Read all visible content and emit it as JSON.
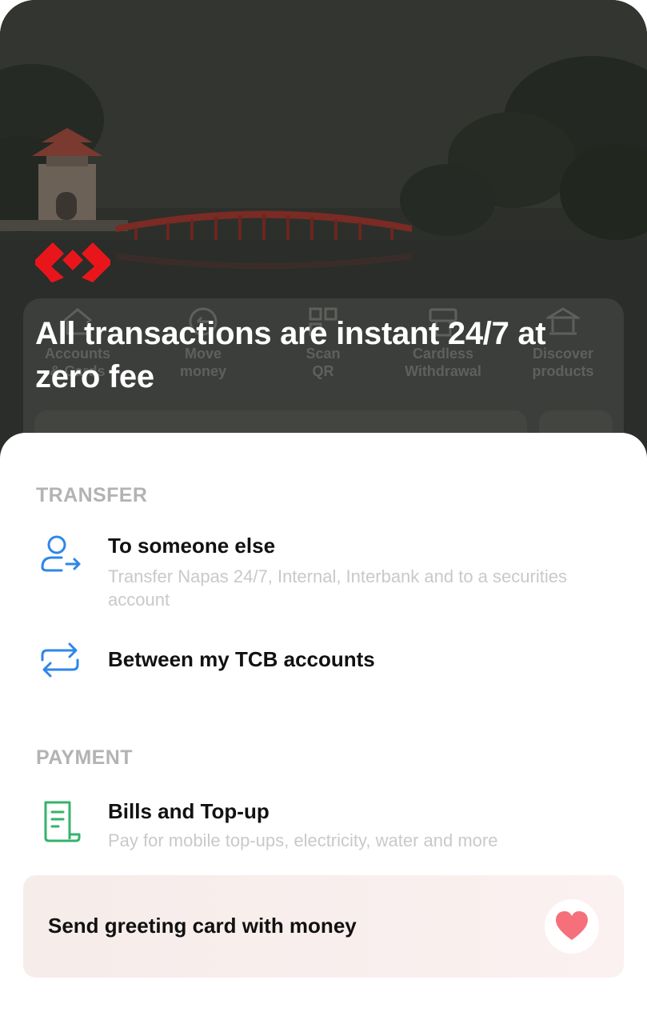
{
  "hero": {
    "headline": "All transactions are instant 24/7 at zero fee",
    "brand_color": "#e8161b"
  },
  "quick_actions": [
    {
      "icon": "accounts-cards-icon",
      "label": "Accounts\n& Cards"
    },
    {
      "icon": "move-money-icon",
      "label": "Move\nmoney"
    },
    {
      "icon": "scan-qr-icon",
      "label": "Scan\nQR"
    },
    {
      "icon": "cardless-withdrawal-icon",
      "label": "Cardless\nWithdrawal"
    },
    {
      "icon": "discover-products-icon",
      "label": "Discover\nproducts"
    }
  ],
  "sheet": {
    "transfer": {
      "title": "TRANSFER",
      "items": [
        {
          "icon": "user-transfer-icon",
          "title": "To someone else",
          "subtitle": "Transfer Napas 24/7, Internal, Interbank and to a securities account"
        },
        {
          "icon": "swap-arrows-icon",
          "title": "Between my TCB accounts"
        }
      ]
    },
    "payment": {
      "title": "PAYMENT",
      "items": [
        {
          "icon": "bill-receipt-icon",
          "title": "Bills and Top-up",
          "subtitle": "Pay for mobile top-ups, electricity, water and more"
        }
      ]
    },
    "greeting": {
      "label": "Send greeting card with money",
      "icon": "heart-icon"
    }
  },
  "colors": {
    "accent_blue": "#2f86e8",
    "accent_green": "#34b36b",
    "heart": "#f5707a",
    "section_title": "#b3b3b3"
  }
}
